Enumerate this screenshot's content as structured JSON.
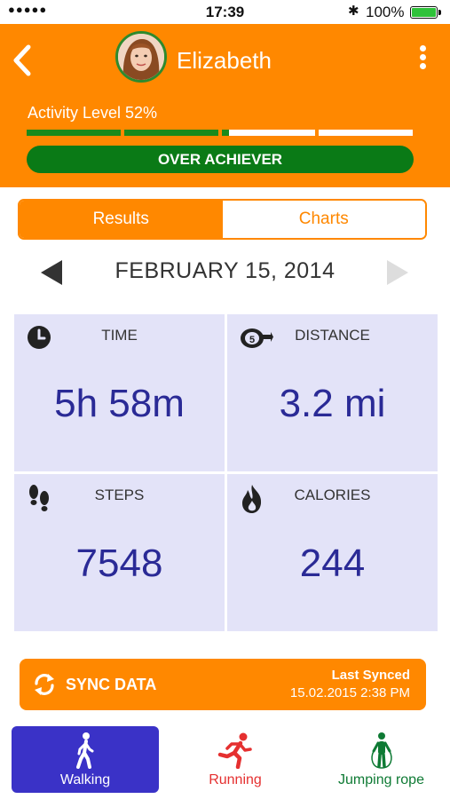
{
  "status_bar": {
    "signal": "●●●●●",
    "time": "17:39",
    "bluetooth": "✱",
    "battery_percent": "100%",
    "battery_level": 1.0
  },
  "header": {
    "user_name": "Elizabeth",
    "activity_label": "Activity Level 52%",
    "activity_level": 0.52,
    "activity_segments": 4,
    "badge": "OVER ACHIEVER",
    "colors": {
      "header_bg": "#ff8800",
      "badge_bg": "#0a7a16",
      "progress": "#1b8a1b"
    }
  },
  "tabs": [
    {
      "label": "Results",
      "active": true
    },
    {
      "label": "Charts",
      "active": false
    }
  ],
  "date_nav": {
    "date": "FEBRUARY 15, 2014"
  },
  "stats": {
    "time": {
      "label": "TIME",
      "value": "5h 58m",
      "icon": "clock-icon"
    },
    "distance": {
      "label": "DISTANCE",
      "value": "3.2 mi",
      "icon": "tape-measure-icon"
    },
    "steps": {
      "label": "STEPS",
      "value": "7548",
      "icon": "footprints-icon"
    },
    "calories": {
      "label": "CALORIES",
      "value": "244",
      "icon": "flame-icon"
    }
  },
  "sync": {
    "label": "SYNC DATA",
    "last_synced_label": "Last Synced",
    "last_synced_value": "15.02.2015 2:38 PM"
  },
  "activities": [
    {
      "label": "Walking",
      "icon": "walking-icon",
      "selected": true,
      "color": "#3a32c7"
    },
    {
      "label": "Running",
      "icon": "running-icon",
      "selected": false,
      "color": "#e53030"
    },
    {
      "label": "Jumping rope",
      "icon": "jumping-rope-icon",
      "selected": false,
      "color": "#0e7a34"
    }
  ]
}
